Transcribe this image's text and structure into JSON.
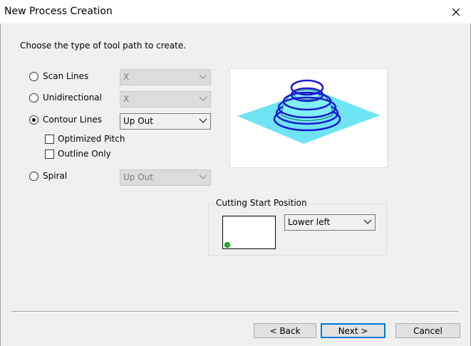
{
  "window": {
    "title": "New Process Creation"
  },
  "instruction": "Choose the type of tool path to create.",
  "options": {
    "scan_lines": {
      "label": "Scan Lines",
      "combo_value": "X"
    },
    "unidirectional": {
      "label": "Unidirectional",
      "combo_value": "X"
    },
    "contour_lines": {
      "label": "Contour Lines",
      "combo_value": "Up Out",
      "selected": true
    },
    "optimized_pitch": {
      "label": "Optimized Pitch",
      "checked": false
    },
    "outline_only": {
      "label": "Outline Only",
      "checked": false
    },
    "spiral": {
      "label": "Spiral",
      "combo_value": "Up Out"
    }
  },
  "cutting_start": {
    "group_label": "Cutting Start Position",
    "combo_value": "Lower left"
  },
  "buttons": {
    "back": "< Back",
    "next": "Next >",
    "cancel": "Cancel"
  },
  "colors": {
    "plane": "#6fe4f5",
    "contour_ring": "#1a1acc",
    "dome": "#7ff0f5",
    "start_marker": "#1ec01e",
    "default_button_border": "#0078d7"
  },
  "icons": [
    "close-icon",
    "chevron-down-icon"
  ]
}
